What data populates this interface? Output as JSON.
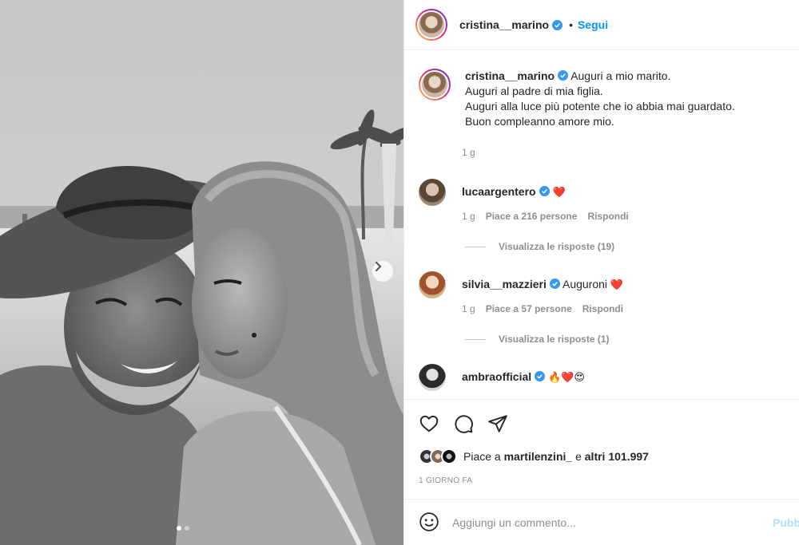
{
  "post": {
    "author": "cristina__marino",
    "follow_label": "Segui",
    "separator": "•",
    "caption_lines": [
      "Auguri a mio marito.",
      "Auguri al padre di mia figlia.",
      "Auguri alla luce più potente che io abbia mai guardato.",
      "Buon compleanno amore mio."
    ],
    "caption_time": "1 g"
  },
  "comments": [
    {
      "user": "luca​argentero",
      "text": "",
      "emojis": "❤️",
      "time": "1 g",
      "likes": "Piace a 216 persone",
      "reply": "Rispondi",
      "view_replies": "Visualizza le risposte (19)"
    },
    {
      "user": "silvia__mazzieri",
      "text": "Auguroni",
      "emojis": "❤️",
      "time": "1 g",
      "likes": "Piace a 57 persone",
      "reply": "Rispondi",
      "view_replies": "Visualizza le risposte (1)"
    },
    {
      "user": "ambraofficial",
      "text": "",
      "emojis": "🔥❤️😍"
    }
  ],
  "likes": {
    "prefix": "Piace a",
    "user": "martilenzini_",
    "middle": "e",
    "others": "altri 101.997"
  },
  "date": "1 GIORNO FA",
  "composer": {
    "placeholder": "Aggiungi un commento...",
    "publish": "Pubb"
  },
  "carousel": {
    "total": 2,
    "active": 1
  },
  "icons": {
    "like": "heart-outline-icon",
    "comment": "speech-bubble-icon",
    "share": "paper-plane-icon",
    "emoji": "smiley-icon",
    "next": "chevron-right-icon"
  },
  "colors": {
    "accent": "#0095f6",
    "muted": "#8e8e8e",
    "verified": "#3897f0",
    "heart": "#ed4956"
  }
}
